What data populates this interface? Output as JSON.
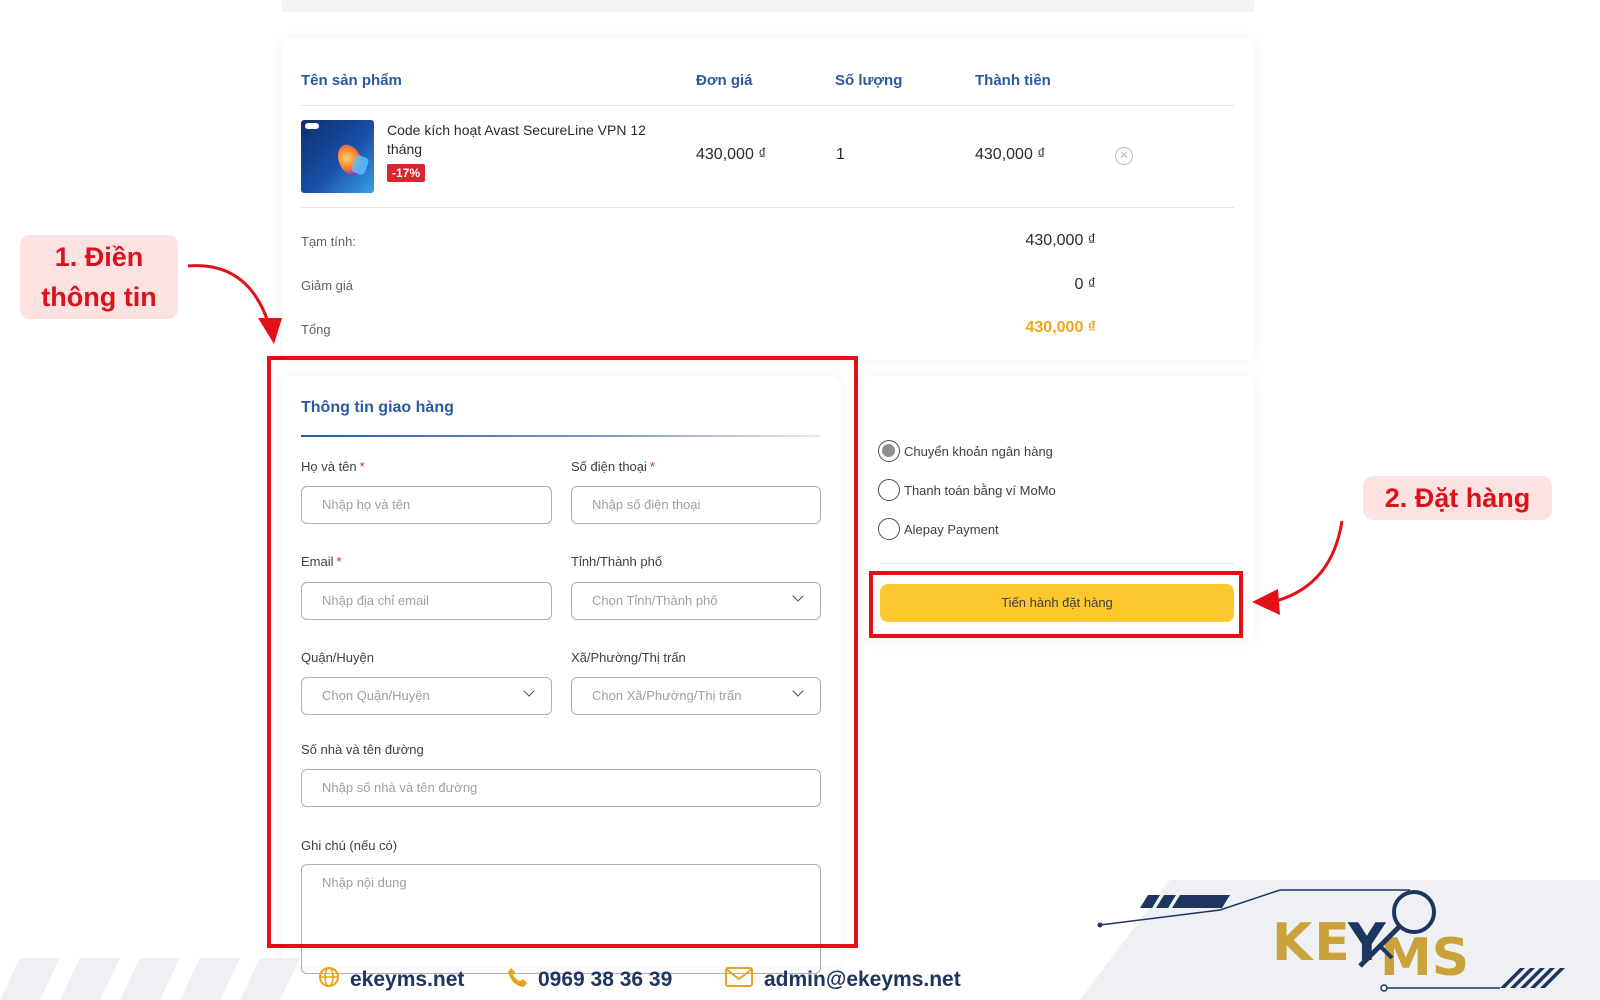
{
  "cart": {
    "headers": {
      "name": "Tên sản phẩm",
      "price": "Đơn giá",
      "qty": "Số lượng",
      "subtotal": "Thành tiền"
    },
    "item": {
      "name": "Code kích hoạt Avast SecureLine VPN 12 tháng",
      "discount_badge": "-17%",
      "price": "430,000 ₫",
      "qty": "1",
      "subtotal": "430,000 ₫"
    },
    "summary": {
      "subtotal_label": "Tạm tính:",
      "subtotal_value": "430,000 ₫",
      "discount_label": "Giảm giá",
      "discount_value": "0 ₫",
      "total_label": "Tổng",
      "total_value": "430,000 ₫"
    }
  },
  "shipping": {
    "title": "Thông tin giao hàng",
    "name_label": "Họ và tên",
    "name_placeholder": "Nhập họ và tên",
    "phone_label": "Số điện thoại",
    "phone_placeholder": "Nhập số điện thoại",
    "email_label": "Email",
    "email_placeholder": "Nhập địa chỉ email",
    "province_label": "Tỉnh/Thành phố",
    "province_value": "Chọn Tỉnh/Thành phố",
    "district_label": "Quận/Huyện",
    "district_value": "Chọn Quận/Huyện",
    "ward_label": "Xã/Phường/Thị trấn",
    "ward_value": "Chọn Xã/Phường/Thị trấn",
    "address_label": "Số nhà và tên đường",
    "address_placeholder": "Nhập số nhà và tên đường",
    "note_label": "Ghi chú (nếu có)",
    "note_placeholder": "Nhập nội dung",
    "required_mark": "*"
  },
  "payment": {
    "options": [
      "Chuyển khoản ngân hàng",
      "Thanh toán bằng ví MoMo",
      "Alepay Payment"
    ],
    "selected": "Chuyển khoản ngân hàng",
    "order_button": "Tiến hành đặt hàng"
  },
  "annotations": {
    "step1_line1": "1. Điền",
    "step1_line2": "thông tin",
    "step2": "2. Đặt hàng"
  },
  "footer": {
    "website": "ekeyms.net",
    "phone": "0969 38 36 39",
    "email": "admin@ekeyms.net",
    "brand": "KEYMS"
  },
  "colors": {
    "accent_blue": "#2a5a9e",
    "total_orange": "#f2a51a",
    "button_yellow": "#fcc82e",
    "annotation_red": "#e3101a",
    "footer_navy": "#1e3560",
    "footer_gold": "#e8a317"
  },
  "icons": [
    "globe-icon",
    "phone-icon",
    "mail-icon",
    "remove-icon",
    "chevron-down-icon",
    "arrow-icon"
  ]
}
